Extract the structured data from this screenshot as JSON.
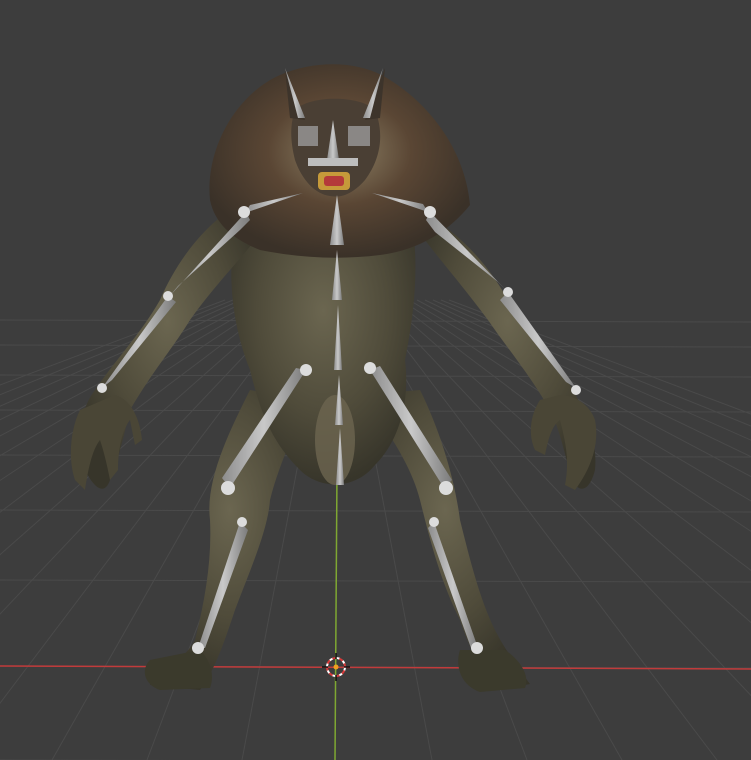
{
  "viewport": {
    "background": "#3d3d3d",
    "grid_color": "#4a4a4a",
    "x_axis_color": "#c23b3b",
    "z_axis_color": "#7fa832",
    "origin_icon": "3d-cursor-icon"
  },
  "model": {
    "subject": "werewolf",
    "fur_colors": [
      "#5e5a44",
      "#4a3a2c",
      "#8a7a5e",
      "#3b3a2c"
    ],
    "bone_color": "#a9a9a9",
    "joint_color": "#dcdcdc"
  }
}
